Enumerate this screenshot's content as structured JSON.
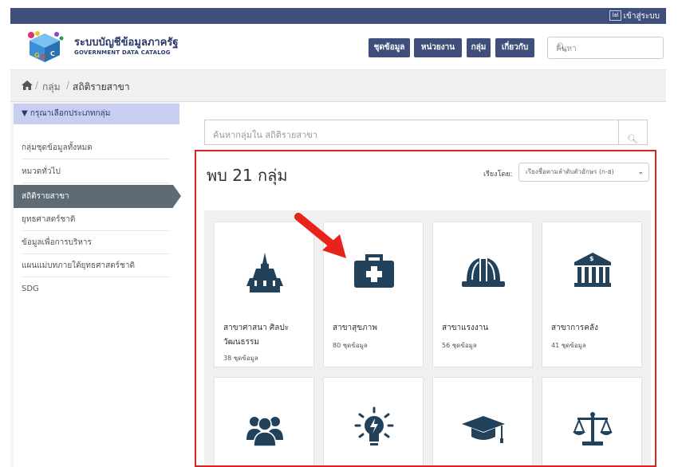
{
  "topbar": {
    "icon_text": "lal",
    "login_label": "เข้าสู่ระบบ"
  },
  "header": {
    "brand_th": "ระบบบัญชีข้อมูลภาครัฐ",
    "brand_en": "GOVERNMENT DATA CATALOG",
    "nav": [
      "ชุดข้อมูล",
      "หน่วยงาน",
      "กลุ่ม",
      "เกี่ยวกับ"
    ],
    "search_placeholder": "ค้นหา"
  },
  "breadcrumb": {
    "items": [
      "กลุ่ม",
      "สถิติรายสาขา"
    ]
  },
  "sidebar": {
    "header": "กรุณาเลือกประเภทกลุ่ม",
    "items": [
      "กลุ่มชุดข้อมูลทั้งหมด",
      "หมวดทั่วไป",
      "สถิติรายสาขา",
      "ยุทธศาสตร์ชาติ",
      "ข้อมูลเพื่อการบริหาร",
      "แผนแม่บทภายใต้ยุทธศาสตร์ชาติ",
      "SDG"
    ],
    "active_index": 2
  },
  "main": {
    "search_placeholder": "ค้นหากลุ่มใน สถิติรายสาขา",
    "found_label": "พบ 21 กลุ่ม",
    "sort_label": "เรียงโดย:",
    "sort_value": "เรียงชื่อตามลำดับตัวอักษร (ก-ฮ)",
    "cards": [
      {
        "title": "สาขาศาสนา ศิลปะ วัฒนธรรม",
        "count": "38 ชุดข้อมูล",
        "icon": "temple-icon"
      },
      {
        "title": "สาขาสุขภาพ",
        "count": "80 ชุดข้อมูล",
        "icon": "medical-kit-icon"
      },
      {
        "title": "สาขาแรงงาน",
        "count": "56 ชุดข้อมูล",
        "icon": "hard-hat-icon"
      },
      {
        "title": "สาขาการคลัง",
        "count": "41 ชุดข้อมูล",
        "icon": "bank-icon"
      },
      {
        "title": "",
        "count": "",
        "icon": "users-icon"
      },
      {
        "title": "",
        "count": "",
        "icon": "lightbulb-icon"
      },
      {
        "title": "",
        "count": "",
        "icon": "graduation-cap-icon"
      },
      {
        "title": "",
        "count": "",
        "icon": "scales-icon"
      }
    ]
  },
  "colors": {
    "navy": "#3f4e7a",
    "icon_blue": "#22425c",
    "highlight_red": "#d22222",
    "sidebar_active": "#5e6a74",
    "sidebar_header": "#c8cef0"
  }
}
